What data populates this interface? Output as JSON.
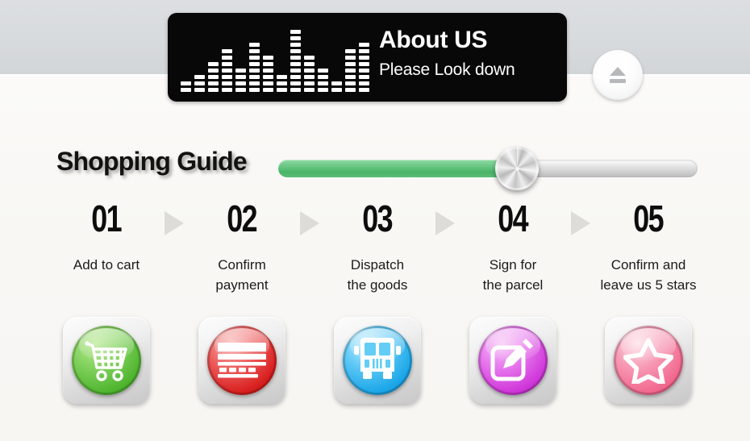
{
  "background": {
    "top_band_color": "#d7dadc",
    "lower_color": "#faf9f7"
  },
  "banner": {
    "title": "About US",
    "subtitle": "Please Look down",
    "background_color": "#080808",
    "text_color": "#ffffff",
    "equalizer_icon": "equalizer-bars-icon",
    "equalizer_levels": [
      2,
      3,
      5,
      7,
      4,
      8,
      6,
      3,
      10,
      6,
      4,
      2,
      7,
      8
    ]
  },
  "eject_button": {
    "icon": "eject-icon",
    "label": "",
    "color": "#b6b8ba"
  },
  "guide": {
    "title": "Shopping Guide",
    "title_color": "#121212"
  },
  "slider": {
    "fill_percent": 57,
    "fill_color": "#49b366",
    "track_color": "#cfcfcf",
    "knob_name": "slider-knob"
  },
  "steps": [
    {
      "number": "01",
      "label": "Add to cart",
      "icon": "shopping-cart-icon",
      "orb_color": "#4fb52f",
      "orb_class": "orb-green"
    },
    {
      "number": "02",
      "label": "Confirm\npayment",
      "icon": "credit-card-icon",
      "orb_color": "#d81f1f",
      "orb_class": "orb-red"
    },
    {
      "number": "03",
      "label": "Dispatch\nthe goods",
      "icon": "delivery-bus-icon",
      "orb_color": "#1ba6e8",
      "orb_class": "orb-blue"
    },
    {
      "number": "04",
      "label": "Sign for\nthe parcel",
      "icon": "sign-pencil-icon",
      "orb_color": "#cf36d8",
      "orb_class": "orb-purple"
    },
    {
      "number": "05",
      "label": "Confirm and\nleave us 5 stars",
      "icon": "star-icon",
      "orb_color": "#f2698f",
      "orb_class": "orb-pink"
    }
  ],
  "arrow_icon": "arrow-right-triangle-icon",
  "arrow_color": "#dedcd9"
}
